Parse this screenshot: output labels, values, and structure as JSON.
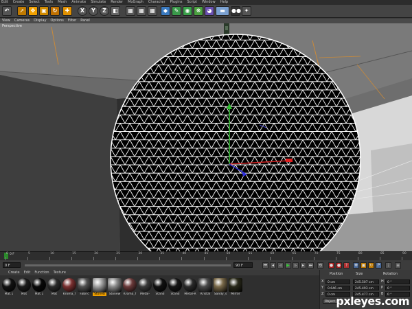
{
  "menu": [
    "Edit",
    "Create",
    "Select",
    "Tools",
    "Mesh",
    "Animate",
    "Simulate",
    "Render",
    "MoGraph",
    "Character",
    "Plugins",
    "Script",
    "Window",
    "Help"
  ],
  "toolbar": {
    "x_label": "X",
    "y_label": "Y",
    "z_label": "Z"
  },
  "viewport_menu": [
    "View",
    "Cameras",
    "Display",
    "Options",
    "Filter",
    "Panel"
  ],
  "viewport_label": "Perspective",
  "timeline": {
    "ticks": [
      "0",
      "5",
      "10",
      "15",
      "20",
      "25",
      "30",
      "35",
      "40",
      "45",
      "50",
      "55",
      "60",
      "65",
      "70",
      "75",
      "80",
      "85",
      "90"
    ],
    "current_frame": "0 F"
  },
  "transport": {
    "start_frame": "0 F",
    "end_frame": "90 F"
  },
  "material_menu": [
    "Create",
    "Edit",
    "Function",
    "Texture"
  ],
  "materials": [
    {
      "name": "Mat.1",
      "color": "#111111"
    },
    {
      "name": "Mat",
      "color": "#1a1a1a"
    },
    {
      "name": "Mat.1",
      "color": "#080808"
    },
    {
      "name": "Mat",
      "color": "#2a2a2a"
    },
    {
      "name": "Kroma_f",
      "color": "#7a3030"
    },
    {
      "name": "Fabric",
      "color": "#505050"
    },
    {
      "name": "Stoneb",
      "color": "#a0a0a0"
    },
    {
      "name": "Stonew",
      "color": "#8a8a8a"
    },
    {
      "name": "Kroma_f",
      "color": "#6a3a3a"
    },
    {
      "name": "Metal-",
      "color": "#3a3a3a"
    },
    {
      "name": "Stand",
      "color": "#101010"
    },
    {
      "name": "Stand",
      "color": "#151515"
    },
    {
      "name": "Metal-R",
      "color": "#2a2a2a"
    },
    {
      "name": "Kristal",
      "color": "#4a4a4a"
    },
    {
      "name": "Sandy_s",
      "color": "#7a6a4a"
    },
    {
      "name": "Mirror",
      "color": "#2a2a1a"
    }
  ],
  "coords": {
    "headers": [
      "Position",
      "Size",
      "Rotation"
    ],
    "rows": [
      {
        "axis": "X",
        "position": "0 cm",
        "size": "245.507 cm",
        "rot_axis": "H",
        "rotation": "0 °"
      },
      {
        "axis": "Y",
        "position": "0.646 cm",
        "size": "245.493 cm",
        "rot_axis": "P",
        "rotation": "0 °"
      },
      {
        "axis": "Z",
        "position": "0 cm",
        "size": "245.477 cm",
        "rot_axis": "B",
        "rotation": "0 °"
      }
    ],
    "mode": "Object"
  },
  "watermark": "pxleyes.com",
  "colors": {
    "accent": "#f0a000",
    "grid": "#ffffff",
    "sphere": "#000000"
  }
}
